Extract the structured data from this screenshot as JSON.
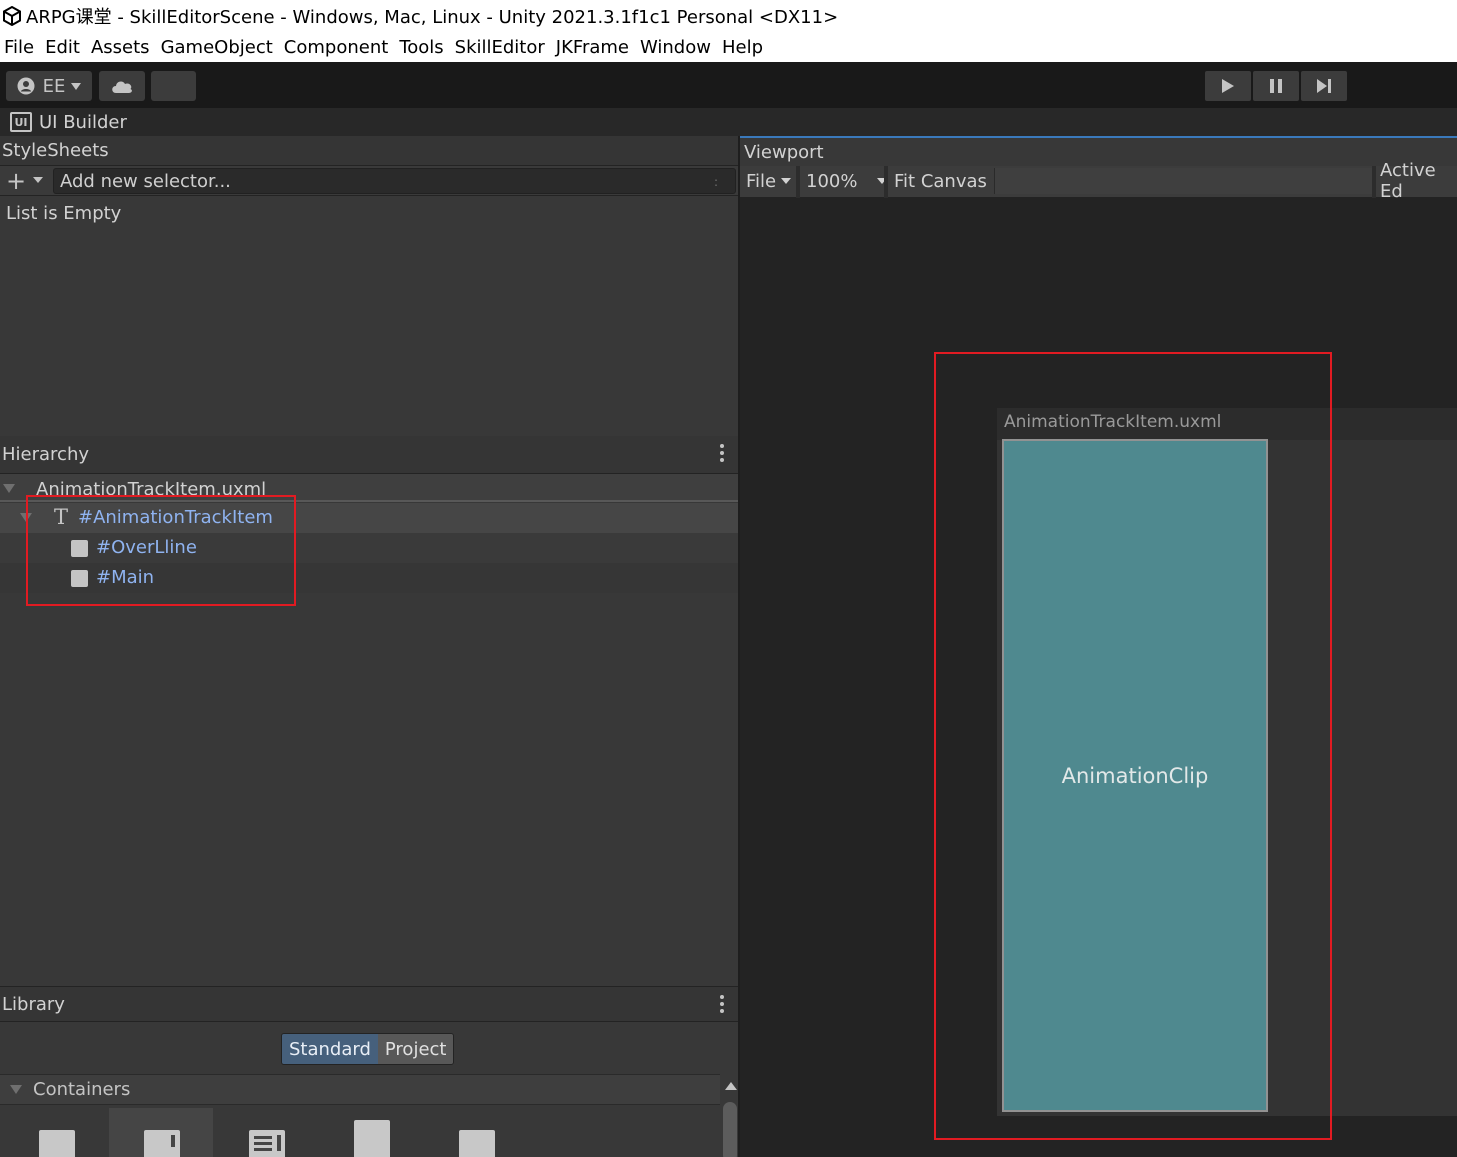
{
  "window": {
    "title": "ARPG课堂 - SkillEditorScene - Windows, Mac, Linux - Unity 2021.3.1f1c1 Personal <DX11>"
  },
  "menu": {
    "items": [
      "File",
      "Edit",
      "Assets",
      "GameObject",
      "Component",
      "Tools",
      "SkillEditor",
      "JKFrame",
      "Window",
      "Help"
    ]
  },
  "toolbar": {
    "account_label": "EE",
    "icons": [
      "account-icon",
      "cloud-icon",
      "play-icon",
      "pause-icon",
      "step-icon"
    ]
  },
  "tab": {
    "title": "UI Builder",
    "icon_text": "UI"
  },
  "stylesheets": {
    "title": "StyleSheets",
    "selector_placeholder": "Add new selector...",
    "handle": ":",
    "empty_text": "List is Empty"
  },
  "hierarchy": {
    "title": "Hierarchy",
    "root": "AnimationTrackItem.uxml",
    "items": [
      {
        "label": "#AnimationTrackItem",
        "icon": "text-element-icon"
      },
      {
        "label": "#OverLline",
        "icon": "visual-element-icon"
      },
      {
        "label": "#Main",
        "icon": "visual-element-icon"
      }
    ]
  },
  "library": {
    "title": "Library",
    "tabs": [
      "Standard",
      "Project"
    ],
    "active_tab": "Standard",
    "section": "Containers"
  },
  "viewport": {
    "title": "Viewport",
    "file_menu": "File",
    "zoom": "100%",
    "fit_canvas": "Fit Canvas",
    "active_editor": "Active Ed",
    "canvas_title": "AnimationTrackItem.uxml",
    "clip_label": "AnimationClip",
    "clip_color": "#4f898f"
  },
  "colors": {
    "highlight": "#e11b22",
    "link_text": "#8fb3f0",
    "active_tab": "#46607c"
  }
}
